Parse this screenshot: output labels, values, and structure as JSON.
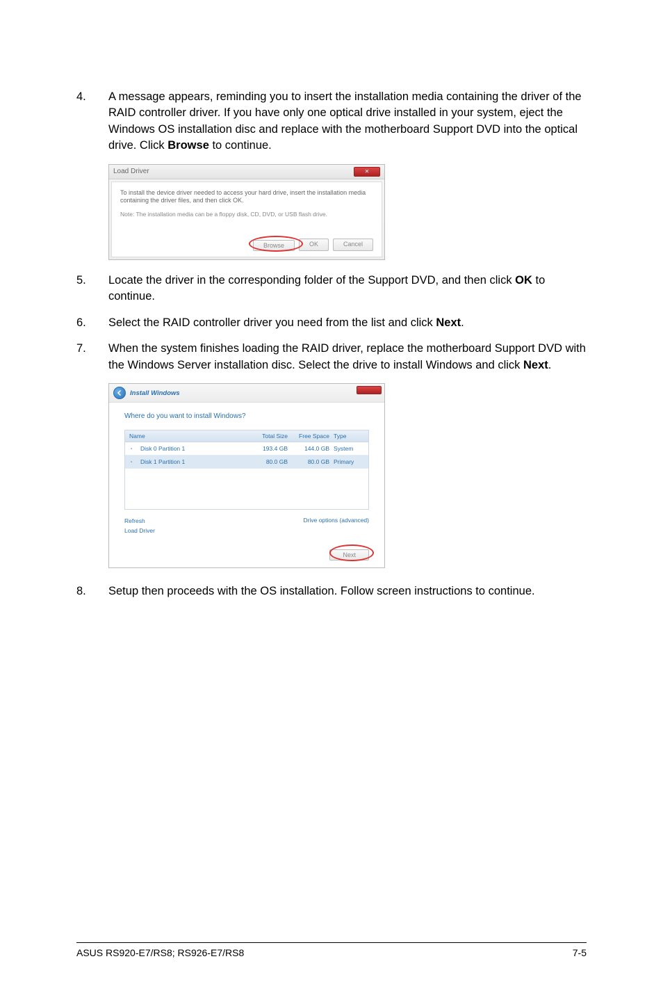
{
  "steps": {
    "s4": {
      "num": "4.",
      "text_a": "A message appears, reminding you to insert the installation media containing the driver of the RAID controller driver. If you have only one optical drive installed in your system, eject the Windows OS installation disc and replace with the motherboard Support DVD into the optical drive. Click ",
      "bold_a": "Browse",
      "text_b": " to continue."
    },
    "s5": {
      "num": "5.",
      "text_a": "Locate the driver in the corresponding folder of the Support DVD, and then click ",
      "bold_a": "OK",
      "text_b": " to continue."
    },
    "s6": {
      "num": "6.",
      "text_a": "Select the RAID controller driver you need from the list and click ",
      "bold_a": "Next",
      "text_b": "."
    },
    "s7": {
      "num": "7.",
      "text_a": "When the system finishes loading the RAID driver, replace the motherboard Support DVD with the Windows Server installation disc. Select the drive to install Windows and click ",
      "bold_a": "Next",
      "text_b": "."
    },
    "s8": {
      "num": "8.",
      "text_a": "Setup then proceeds with the OS installation. Follow screen instructions to continue."
    }
  },
  "dlg1": {
    "title": "Load Driver",
    "main": "To install the device driver needed to access your hard drive, insert the installation media containing the driver files, and then click OK.",
    "note": "Note: The installation media can be a floppy disk, CD, DVD, or USB flash drive.",
    "browse": "Browse",
    "ok": "OK",
    "cancel": "Cancel"
  },
  "dlg2": {
    "hdr": "Install Windows",
    "question": "Where do you want to install Windows?",
    "col_name": "Name",
    "col_total": "Total Size",
    "col_free": "Free Space",
    "col_type": "Type",
    "row1": {
      "name": "Disk 0 Partition 1",
      "total": "193.4 GB",
      "free": "144.0 GB",
      "type": "System"
    },
    "row2": {
      "name": "Disk 1 Partition 1",
      "total": "80.0 GB",
      "free": "80.0 GB",
      "type": "Primary"
    },
    "refresh": "Refresh",
    "load": "Load Driver",
    "advanced": "Drive options (advanced)",
    "next": "Next"
  },
  "footer": {
    "left": "ASUS RS920-E7/RS8; RS926-E7/RS8",
    "right": "7-5"
  }
}
